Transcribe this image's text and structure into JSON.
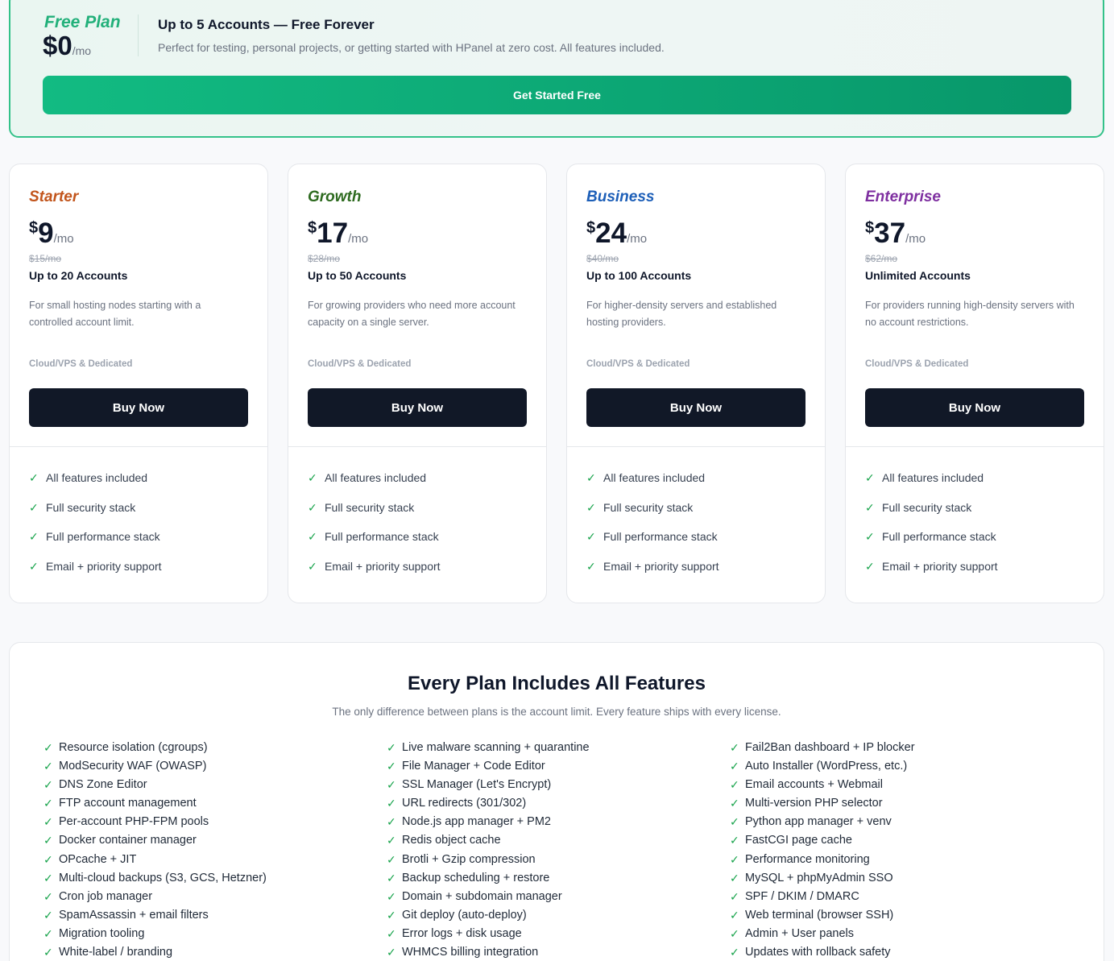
{
  "free_plan": {
    "name": "Free Plan",
    "price": "$0",
    "per": "/mo",
    "title": "Up to 5 Accounts — Free Forever",
    "description": "Perfect for testing, personal projects, or getting started with HPanel at zero cost. All features included.",
    "button": "Get Started Free",
    "accent_color": "#22b07a"
  },
  "plans": [
    {
      "name": "Starter",
      "color": "#c2551c",
      "currency": "$",
      "price": "9",
      "per": "/mo",
      "old_price": "$15/mo",
      "accounts": "Up to 20 Accounts",
      "description": "For small hosting nodes starting with a controlled account limit.",
      "type": "Cloud/VPS & Dedicated",
      "button": "Buy Now"
    },
    {
      "name": "Growth",
      "color": "#2d6a1f",
      "currency": "$",
      "price": "17",
      "per": "/mo",
      "old_price": "$28/mo",
      "accounts": "Up to 50 Accounts",
      "description": "For growing providers who need more account capacity on a single server.",
      "type": "Cloud/VPS & Dedicated",
      "button": "Buy Now"
    },
    {
      "name": "Business",
      "color": "#1d5fb8",
      "currency": "$",
      "price": "24",
      "per": "/mo",
      "old_price": "$40/mo",
      "accounts": "Up to 100 Accounts",
      "description": "For higher-density servers and established hosting providers.",
      "type": "Cloud/VPS & Dedicated",
      "button": "Buy Now"
    },
    {
      "name": "Enterprise",
      "color": "#7e2fa0",
      "currency": "$",
      "price": "37",
      "per": "/mo",
      "old_price": "$62/mo",
      "accounts": "Unlimited Accounts",
      "description": "For providers running high-density servers with no account restrictions.",
      "type": "Cloud/VPS & Dedicated",
      "button": "Buy Now"
    }
  ],
  "plan_features": [
    "All features included",
    "Full security stack",
    "Full performance stack",
    "Email + priority support"
  ],
  "check_icon": "✓",
  "all_features": {
    "title": "Every Plan Includes All Features",
    "subtitle": "The only difference between plans is the account limit. Every feature ships with every license.",
    "columns": [
      [
        "Resource isolation (cgroups)",
        "ModSecurity WAF (OWASP)",
        "DNS Zone Editor",
        "FTP account management",
        "Per-account PHP-FPM pools",
        "Docker container manager",
        "OPcache + JIT",
        "Multi-cloud backups (S3, GCS, Hetzner)",
        "Cron job manager",
        "SpamAssassin + email filters",
        "Migration tooling",
        "White-label / branding"
      ],
      [
        "Live malware scanning + quarantine",
        "File Manager + Code Editor",
        "SSL Manager (Let's Encrypt)",
        "URL redirects (301/302)",
        "Node.js app manager + PM2",
        "Redis object cache",
        "Brotli + Gzip compression",
        "Backup scheduling + restore",
        "Domain + subdomain manager",
        "Git deploy (auto-deploy)",
        "Error logs + disk usage",
        "WHMCS billing integration"
      ],
      [
        "Fail2Ban dashboard + IP blocker",
        "Auto Installer (WordPress, etc.)",
        "Email accounts + Webmail",
        "Multi-version PHP selector",
        "Python app manager + venv",
        "FastCGI page cache",
        "Performance monitoring",
        "MySQL + phpMyAdmin SSO",
        "SPF / DKIM / DMARC",
        "Web terminal (browser SSH)",
        "Admin + User panels",
        "Updates with rollback safety"
      ]
    ]
  }
}
